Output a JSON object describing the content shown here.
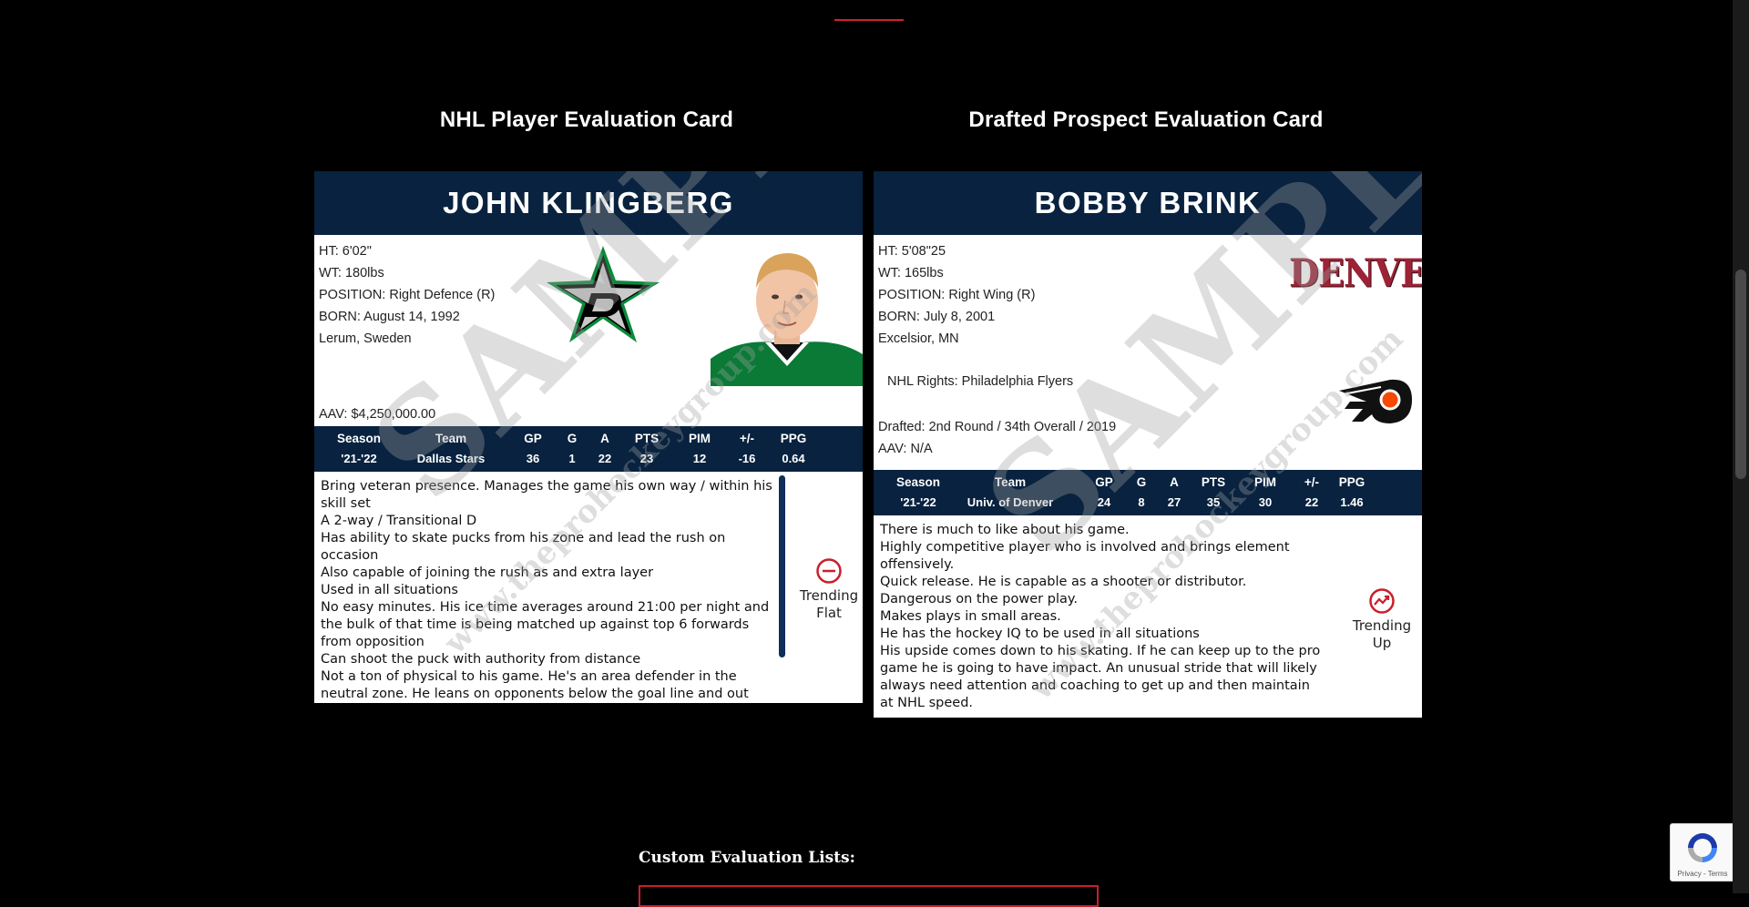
{
  "sections": {
    "left_title": "NHL Player Evaluation Card",
    "right_title": "Drafted Prospect Evaluation Card"
  },
  "watermark": {
    "main": "SAMPLE",
    "url": "www.theprohockeygroup.com"
  },
  "card1": {
    "name": "JOHN KLINGBERG",
    "bio": {
      "ht": "HT: 6'02\"",
      "wt": "WT: 180lbs",
      "position": "POSITION: Right Defence (R)",
      "born": "BORN: August 14, 1992",
      "birthplace": "Lerum, Sweden"
    },
    "aav": "AAV: $4,250,000.00",
    "team_logo": "dallas-stars-logo",
    "stats_headers": [
      "Season",
      "Team",
      "GP",
      "G",
      "A",
      "PTS",
      "PIM",
      "+/-",
      "PPG"
    ],
    "stats_values": [
      "'21-'22",
      "Dallas Stars",
      "36",
      "1",
      "22",
      "23",
      "12",
      "-16",
      "0.64"
    ],
    "notes": [
      "Bring veteran presence. Manages the game his own way / within his skill set",
      "A 2-way / Transitional D",
      "Has ability to skate pucks from his zone and lead the rush on occasion",
      "Also capable of joining the rush as and extra layer",
      "Used in all situations",
      "No easy minutes. His ice time averages around 21:00 per night and the bulk of that time is being matched up against top 6 forwards from opposition",
      "Can shoot the puck with authority from distance",
      "Not a ton of physical to his game. He's an area defender in the neutral zone. He leans on opponents below the goal line and out front his net"
    ],
    "trend": {
      "line1": "Trending",
      "line2": "Flat",
      "icon": "trending-flat-icon",
      "color": "#c8202c"
    }
  },
  "card2": {
    "name": "BOBBY BRINK",
    "bio": {
      "ht": "HT: 5'08\"25",
      "wt": "WT: 165lbs",
      "position": "POSITION: Right Wing (R)",
      "born": "BORN: July 8, 2001",
      "birthplace": "Excelsior, MN"
    },
    "rights": "NHL Rights: Philadelphia Flyers",
    "drafted": "Drafted: 2nd Round / 34th Overall / 2019",
    "aav": "AAV: N/A",
    "college_logo_text": "DENVER",
    "nhl_logo": "philadelphia-flyers-logo",
    "stats_headers": [
      "Season",
      "Team",
      "GP",
      "G",
      "A",
      "PTS",
      "PIM",
      "+/-",
      "PPG"
    ],
    "stats_values": [
      "'21-'22",
      "Univ. of Denver",
      "24",
      "8",
      "27",
      "35",
      "30",
      "22",
      "1.46"
    ],
    "notes": [
      "There is much to like about his game.",
      "Highly competitive player who is involved and brings element offensively.",
      "Quick release. He is capable as a shooter or distributor.",
      "Dangerous on the power play.",
      "Makes plays in small areas.",
      "He has the hockey IQ to be used in all situations",
      "His upside comes down to his skating. If he can keep up to the pro game he is going to have impact. An unusual stride that will likely always need attention and coaching to get up and then maintain at NHL speed."
    ],
    "trend": {
      "line1": "Trending",
      "line2": "Up",
      "icon": "trending-up-icon",
      "color": "#c8202c"
    }
  },
  "custom_lists_label": "Custom Evaluation Lists:",
  "recaptcha": {
    "text": "Privacy - Terms"
  },
  "colors": {
    "header_navy": "#08223f",
    "accent_red": "#c8202c"
  }
}
